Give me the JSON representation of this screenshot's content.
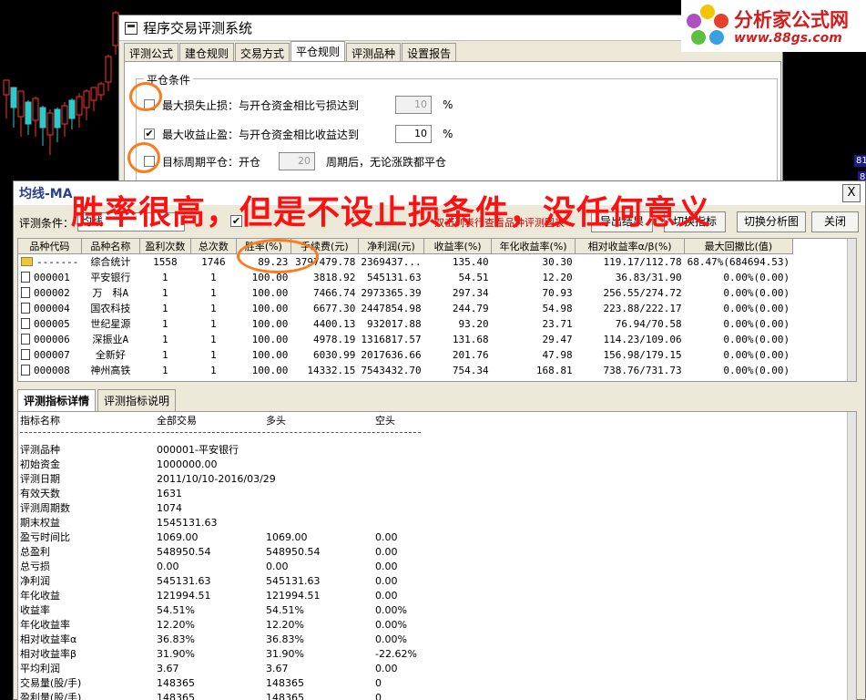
{
  "back_dialog": {
    "title": "程序交易评测系统",
    "tabs": [
      "评测公式",
      "建仓规则",
      "交易方式",
      "平仓规则",
      "评测品种",
      "设置报告"
    ],
    "active_tab": 3,
    "group_label": "平仓条件",
    "rows": [
      {
        "checked": false,
        "check_mark": "",
        "label": "最大损失止损：与开仓资金相比亏损达到",
        "value": "10",
        "unit": "%",
        "disabled": true
      },
      {
        "checked": true,
        "check_mark": "✔",
        "label": "最大收益止盈：与开仓资金相比收益达到",
        "value": "10",
        "unit": "%",
        "disabled": false
      }
    ],
    "period_row": {
      "checked": false,
      "label_prefix": "目标周期平仓：开仓",
      "value": "20",
      "label_suffix": "周期后，无论涨跌都平仓",
      "disabled": true
    }
  },
  "logo": {
    "brand": "分析家公式网",
    "url": "www.88gs.com"
  },
  "side_labels": [
    "81",
    "8"
  ],
  "front_window": {
    "title": "均线-MA",
    "close_glyph": "X",
    "toolbar": {
      "label": "评测条件：",
      "combo_value": "均线",
      "check_mark": "✔",
      "hint": "双击列表行查看品种评测图表",
      "buttons": [
        "导出结果",
        "切换指标",
        "切换分析图",
        "关闭"
      ]
    },
    "columns": [
      "品种代码",
      "品种名称",
      "盈利次数",
      "总次数",
      "胜率(%)",
      "手续费(元)",
      "净利润(元)",
      "收益率(%)",
      "年化收益率(%)",
      "相对收益率α/β(%)",
      "最大回撤比(值)"
    ],
    "rows": [
      {
        "code": "-------",
        "name": "综合统计",
        "wins": "1558",
        "total": "1746",
        "rate": "89.23",
        "fee": "3797479.78",
        "profit": "2369437...",
        "ret": "135.40",
        "annual": "30.30",
        "rel": "119.17/112.78",
        "dd": "68.47%(684694.53)",
        "summary": true
      },
      {
        "code": "000001",
        "name": "平安银行",
        "wins": "1",
        "total": "1",
        "rate": "100.00",
        "fee": "3818.92",
        "profit": "545131.63",
        "ret": "54.51",
        "annual": "12.20",
        "rel": "36.83/31.90",
        "dd": "0.00%(0.00)"
      },
      {
        "code": "000002",
        "name": "万　科A",
        "wins": "1",
        "total": "1",
        "rate": "100.00",
        "fee": "7466.74",
        "profit": "2973365.39",
        "ret": "297.34",
        "annual": "70.93",
        "rel": "256.55/274.72",
        "dd": "0.00%(0.00)"
      },
      {
        "code": "000004",
        "name": "国农科技",
        "wins": "1",
        "total": "1",
        "rate": "100.00",
        "fee": "6677.30",
        "profit": "2447854.98",
        "ret": "244.79",
        "annual": "54.98",
        "rel": "223.88/222.17",
        "dd": "0.00%(0.00)"
      },
      {
        "code": "000005",
        "name": "世纪星源",
        "wins": "1",
        "total": "1",
        "rate": "100.00",
        "fee": "4400.13",
        "profit": "932017.88",
        "ret": "93.20",
        "annual": "23.71",
        "rel": "76.94/70.58",
        "dd": "0.00%(0.00)"
      },
      {
        "code": "000006",
        "name": "深振业A",
        "wins": "1",
        "total": "1",
        "rate": "100.00",
        "fee": "4978.19",
        "profit": "1316817.57",
        "ret": "131.68",
        "annual": "29.47",
        "rel": "114.23/109.06",
        "dd": "0.00%(0.00)"
      },
      {
        "code": "000007",
        "name": "全新好",
        "wins": "1",
        "total": "1",
        "rate": "100.00",
        "fee": "6030.99",
        "profit": "2017636.66",
        "ret": "201.76",
        "annual": "47.98",
        "rel": "156.98/179.15",
        "dd": "0.00%(0.00)"
      },
      {
        "code": "000008",
        "name": "神州高铁",
        "wins": "1",
        "total": "1",
        "rate": "100.00",
        "fee": "14332.15",
        "profit": "7543432.70",
        "ret": "754.34",
        "annual": "168.81",
        "rel": "738.76/731.73",
        "dd": "0.00%(0.00)"
      }
    ],
    "detail_tabs": [
      "评测指标详情",
      "评测指标说明"
    ],
    "detail_header": [
      "指标名称",
      "全部交易",
      "多头",
      "空头"
    ],
    "detail_rows": [
      [
        "评测品种",
        "000001-平安银行",
        "",
        ""
      ],
      [
        "初始资金",
        "1000000.00",
        "",
        ""
      ],
      [
        "评测日期",
        "2011/10/10-2016/03/29",
        "",
        ""
      ],
      [
        "有效天数",
        "1631",
        "",
        ""
      ],
      [
        "评测周期数",
        "1074",
        "",
        ""
      ],
      [
        "期末权益",
        "1545131.63",
        "",
        ""
      ],
      [
        "盈亏时间比",
        "1069.00",
        "1069.00",
        "0.00"
      ],
      [
        "总盈利",
        "548950.54",
        "548950.54",
        "0.00"
      ],
      [
        "总亏损",
        "0.00",
        "0.00",
        "0.00"
      ],
      [
        "净利润",
        "545131.63",
        "545131.63",
        "0.00"
      ],
      [
        "年化收益",
        "121994.51",
        "121994.51",
        "0.00"
      ],
      [
        "收益率",
        "54.51%",
        "54.51%",
        "0.00%"
      ],
      [
        "年化收益率",
        "12.20%",
        "12.20%",
        "0.00%"
      ],
      [
        "相对收益率α",
        "36.83%",
        " 36.83%",
        "  0.00%"
      ],
      [
        "相对收益率β",
        "31.90%",
        " 31.90%",
        " -22.62%"
      ],
      [
        "平均利润",
        "3.67",
        "3.67",
        "0.00"
      ],
      [
        "交易量(股/手)",
        "148365",
        "148365",
        "0"
      ],
      [
        "盈利量(股/手)",
        "148365",
        "148365",
        "0"
      ]
    ]
  },
  "annotation": {
    "banner": "胜率很高，但是不设止损条件，没任何意义",
    "ring_color": "#ff7a1a",
    "text_color": "#ff1010"
  },
  "colors": {
    "up": "#ff3030",
    "down": "#30c8c8",
    "dialog_bg": "#ece9d8"
  }
}
